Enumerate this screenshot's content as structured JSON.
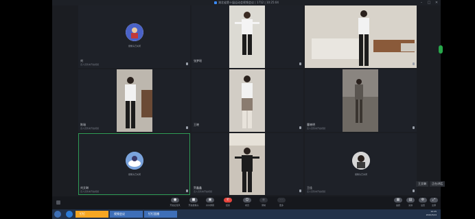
{
  "window": {
    "title": "湖北省第十届运动会视频会议 | 1712 | 10:25:04",
    "minimize_icon": "minimize-icon",
    "maximize_icon": "maximize-icon",
    "close_icon": "close-icon"
  },
  "participants": [
    {
      "name": "刘",
      "status": "该人员暂未开启视频",
      "video": false,
      "avatar_caption": "摄像头已关闭"
    },
    {
      "name": "张梦瑶",
      "status": "",
      "video": true
    },
    {
      "name": "",
      "status": "",
      "video": true
    },
    {
      "name": "陈瑞",
      "status": "该人员暂未开启视频",
      "video": true
    },
    {
      "name": "王晓",
      "status": "",
      "video": true
    },
    {
      "name": "曹晓明",
      "status": "该人员暂未开启视频",
      "video": true
    },
    {
      "name": "刘艾琳",
      "status": "该人员暂未开启视频",
      "video": false,
      "avatar_caption": "摄像头已关闭",
      "active": true
    },
    {
      "name": "贺鑫鑫",
      "status": "该人员暂未开启视频",
      "video": true
    },
    {
      "name": "王佳",
      "status": "该人员暂未开启视频",
      "video": false,
      "avatar_caption": "摄像头已关闭"
    }
  ],
  "toolbar": {
    "buttons": [
      {
        "label": "开启麦克风",
        "icon": "microphone-icon"
      },
      {
        "label": "开启摄像头",
        "icon": "camera-icon"
      },
      {
        "label": "共享屏幕",
        "icon": "share-screen-icon"
      },
      {
        "label": "结束",
        "icon": "hang-up-icon"
      },
      {
        "label": "成员",
        "icon": "members-icon"
      },
      {
        "label": "录制",
        "icon": "record-icon"
      },
      {
        "label": "更多",
        "icon": "more-icon"
      }
    ],
    "right": [
      {
        "label": "画廊",
        "icon": "gallery-icon"
      },
      {
        "label": "演讲",
        "icon": "speaker-icon"
      },
      {
        "label": "设置",
        "icon": "settings-icon"
      },
      {
        "label": "全屏",
        "icon": "fullscreen-icon"
      }
    ]
  },
  "overlay": {
    "label": "王艾琳",
    "tag": "正在讲话"
  },
  "taskbar": {
    "tasks": [
      {
        "label": "钉钉",
        "highlight": "#f5a623"
      },
      {
        "label": "视频会议"
      },
      {
        "label": "钉钉直播"
      }
    ],
    "clock_time": "10:25",
    "clock_date": "2020/3/24"
  },
  "colors": {
    "active_border": "#2f9c56",
    "leave": "#e6453d",
    "side_tab": "#27a74a"
  }
}
